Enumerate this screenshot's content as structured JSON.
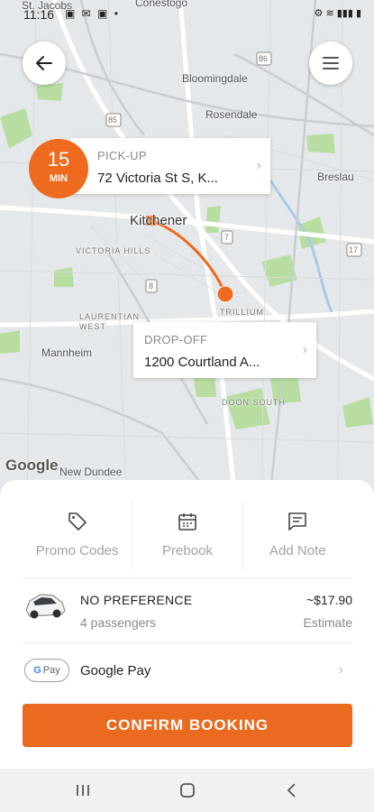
{
  "status_bar": {
    "time": "11:16",
    "left_icons": "▣ ✉ ▣ •",
    "right_icons": "⚙ ≋ ▮▮▮ ▮"
  },
  "map": {
    "places": {
      "st_jacobs": "St. Jacobs",
      "conestogo": "Conestogo",
      "bloomingdale": "Bloomingdale",
      "rosendale": "Rosendale",
      "breslau": "Breslau",
      "kitchener": "Kitchener",
      "victoria_hills": "VICTORIA HILLS",
      "trillium": "TRILLIUM",
      "laurentian_west": "LAURENTIAN\nWEST",
      "mannheim": "Mannheim",
      "doon_south": "DOON SOUTH",
      "new_dundee": "New Dundee",
      "highway_85": "85",
      "highway_8": "8",
      "highway_7": "7",
      "highway_86": "86",
      "highway_17": "17"
    },
    "google_logo": "Google",
    "colors": {
      "route": "#ee6a1e",
      "park": "#a8d88a",
      "water": "#9ec4e8"
    }
  },
  "eta": {
    "value": "15",
    "unit": "MIN"
  },
  "pickup": {
    "label": "PICK-UP",
    "address": "72 Victoria St S, K..."
  },
  "dropoff": {
    "label": "DROP-OFF",
    "address": "1200 Courtland A..."
  },
  "actions": [
    {
      "label": "Promo Codes",
      "icon": "tag-icon"
    },
    {
      "label": "Prebook",
      "icon": "calendar-icon"
    },
    {
      "label": "Add Note",
      "icon": "note-icon"
    }
  ],
  "ride": {
    "title": "NO PREFERENCE",
    "passengers": "4 passengers",
    "price": "~$17.90",
    "estimate": "Estimate"
  },
  "payment": {
    "badge": "G Pay",
    "badge_g": "G",
    "badge_pay": "Pay",
    "label": "Google Pay"
  },
  "confirm_button": "CONFIRM BOOKING",
  "nav": {
    "recents": "|||",
    "home": "○",
    "back": "<"
  },
  "colors": {
    "accent": "#ea6a1f"
  }
}
